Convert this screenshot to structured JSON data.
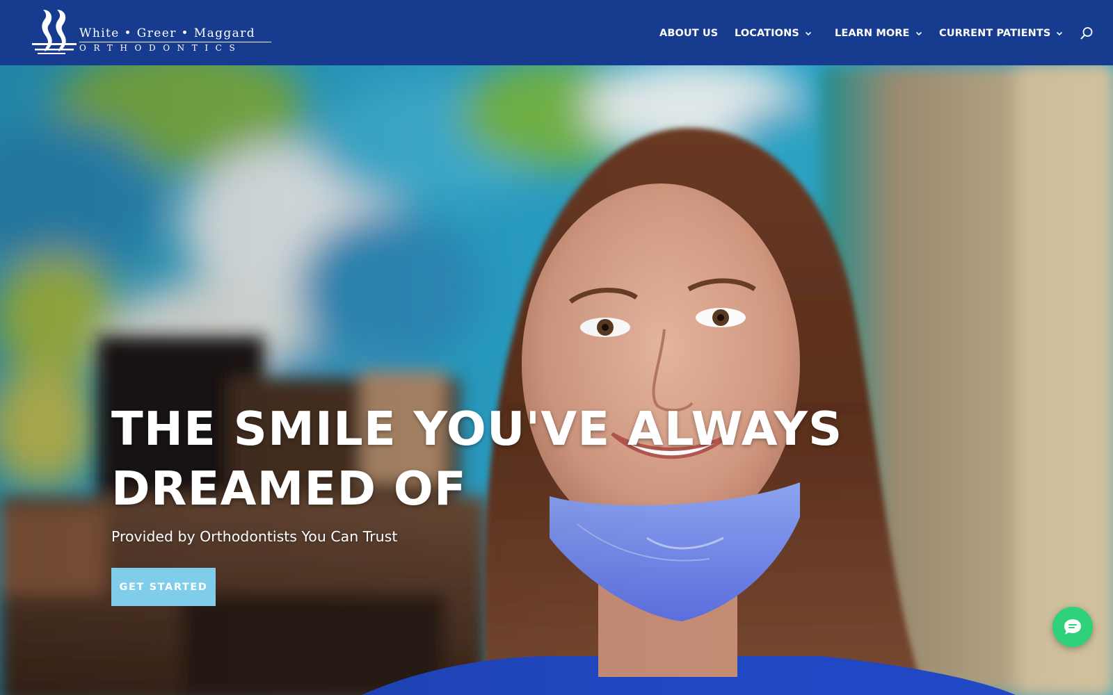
{
  "brand": {
    "name": "White • Greer • Maggard",
    "subtitle": "ORTHODONTICS"
  },
  "nav": {
    "items": [
      {
        "label": "ABOUT US",
        "has_dropdown": false
      },
      {
        "label": "LOCATIONS",
        "has_dropdown": true
      },
      {
        "label": "LEARN MORE",
        "has_dropdown": true
      },
      {
        "label": "CURRENT PATIENTS",
        "has_dropdown": true
      }
    ],
    "search_icon": "search-icon"
  },
  "hero": {
    "title_line1": "THE SMILE YOU'VE ALWAYS",
    "title_line2": "DREAMED OF",
    "subtitle": "Provided by Orthodontists You Can Trust",
    "cta_label": "GET STARTED"
  },
  "chat": {
    "icon": "chat-icon"
  },
  "colors": {
    "header_bg": "#173b8f",
    "cta_bg": "#7fcdea",
    "chat_bg": "#2fd27a",
    "text": "#ffffff"
  }
}
